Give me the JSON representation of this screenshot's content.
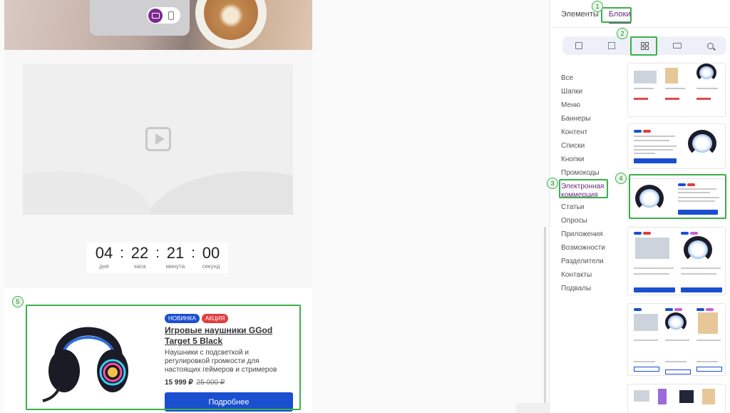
{
  "canvas": {
    "countdown": {
      "items": [
        {
          "value": "04",
          "label": "дня"
        },
        {
          "value": "22",
          "label": "часа"
        },
        {
          "value": "21",
          "label": "минута"
        },
        {
          "value": "00",
          "label": "секунд"
        }
      ],
      "separator": ":"
    },
    "product": {
      "badges": [
        {
          "label": "НОВИНКА",
          "color": "#1a4fd0"
        },
        {
          "label": "АКЦИЯ",
          "color": "#e23d3d"
        }
      ],
      "title": "Игровые наушники GGod Target 5 Black",
      "description": "Наушники с подсветкой и регулировкой громкости для настоящих геймеров и стримеров",
      "price": "15 999 ₽",
      "old_price": "25 000 ₽",
      "button_label": "Подробнее"
    }
  },
  "panel": {
    "tabs": [
      {
        "label": "Элементы",
        "active": false
      },
      {
        "label": "Блоки",
        "active": true
      }
    ],
    "toolbar_icons": [
      "section-icon",
      "add-block-icon",
      "blocks-grid-icon",
      "layout-icon",
      "search-icon"
    ],
    "categories": [
      {
        "label": "Все"
      },
      {
        "label": "Шапки"
      },
      {
        "label": "Меню"
      },
      {
        "label": "Баннеры"
      },
      {
        "label": "Контент"
      },
      {
        "label": "Списки"
      },
      {
        "label": "Кнопки"
      },
      {
        "label": "Промокоды"
      },
      {
        "label": "Электронная коммерция",
        "active": true
      },
      {
        "label": "Статьи"
      },
      {
        "label": "Опросы"
      },
      {
        "label": "Приложения"
      },
      {
        "label": "Возможности"
      },
      {
        "label": "Разделители"
      },
      {
        "label": "Контакты"
      },
      {
        "label": "Подвалы"
      }
    ],
    "thumb_button_label": "Подробнее"
  },
  "annotations": [
    "1",
    "2",
    "3",
    "4",
    "5"
  ],
  "colors": {
    "accent": "#6a2a82",
    "highlight": "#3bb04a",
    "primary_button": "#1a4fd0",
    "badge_red": "#e23d3d"
  }
}
